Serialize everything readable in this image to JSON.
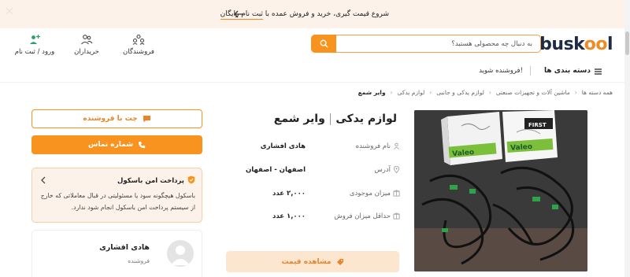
{
  "banner": {
    "text_pre": "شروع قیمت گیری، خرید و فروش عمده با ",
    "text_link": "ثبت نام رایگان"
  },
  "header": {
    "logo_main": "busk",
    "logo_accent": "oo",
    "logo_end": "l",
    "search_placeholder": "به دنبال چه محصولی هستید؟",
    "sellers_label": "فروشندگان",
    "buyers_label": "خریداران",
    "login_label": "ورود / ثبت نام"
  },
  "nav": {
    "categories_label": "دسته بندی ها",
    "become_seller_label": "فروشنده شوید!"
  },
  "breadcrumb": [
    "همه دسته ها",
    "ماشین آلات و تجهیزات صنعتی",
    "لوازم یدکی و جانبی",
    "لوازم یدکی",
    "وایر شمع"
  ],
  "product": {
    "title_part1": "لوازم یدکی",
    "title_part2": "وایر شمع",
    "info": [
      {
        "label": "نام فروشنده",
        "value": "هادی افشاری",
        "icon": "user-icon"
      },
      {
        "label": "آدرس",
        "value": "اصفهان - اصفهان",
        "icon": "location-icon"
      },
      {
        "label": "میزان موجودی",
        "value": "۲,۰۰۰ عدد",
        "icon": "box-icon"
      },
      {
        "label": "حداقل میزان فروش",
        "value": "۱,۰۰۰ عدد",
        "icon": "box-icon"
      }
    ],
    "view_price_label": "مشاهده قیمت",
    "image_box_brand": "Valeo",
    "image_box_label": "FIRST"
  },
  "seller_panel": {
    "chat_label": "چت با فروشنده",
    "call_label": "شماره تماس",
    "safe_pay_title": "پرداخت امن باسکول",
    "safe_pay_text": "باسکول هیچگونه سود یا مسئولیتی در قبال معاملاتی که خارج از سیستم پرداخت امن باسکول انجام شود ندارد.",
    "seller_name": "هادی افشاری",
    "seller_role": "فروشنده"
  },
  "colors": {
    "accent": "#f7931e",
    "accent_light": "#fde6cf",
    "banner_bg": "#fdf2ea",
    "logo_dark": "#1f2a44"
  }
}
